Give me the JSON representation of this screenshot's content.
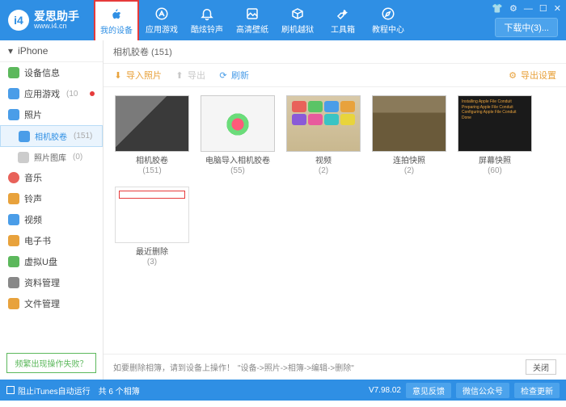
{
  "brand": {
    "name": "爱思助手",
    "url": "www.i4.cn"
  },
  "nav": [
    {
      "label": "我的设备"
    },
    {
      "label": "应用游戏"
    },
    {
      "label": "酷炫铃声"
    },
    {
      "label": "高清壁纸"
    },
    {
      "label": "刷机越狱"
    },
    {
      "label": "工具箱"
    },
    {
      "label": "教程中心"
    }
  ],
  "download_btn": "下载中(3)...",
  "sidebar": {
    "device": "iPhone",
    "items": [
      {
        "label": "设备信息"
      },
      {
        "label": "应用游戏",
        "count": "(10",
        "dot": true
      },
      {
        "label": "照片"
      },
      {
        "label": "相机胶卷",
        "count": "(151)",
        "sub": true,
        "selected": true
      },
      {
        "label": "照片图库",
        "count": "(0)",
        "sub": true
      },
      {
        "label": "音乐"
      },
      {
        "label": "铃声"
      },
      {
        "label": "视频"
      },
      {
        "label": "电子书"
      },
      {
        "label": "虚拟U盘"
      },
      {
        "label": "资料管理"
      },
      {
        "label": "文件管理"
      }
    ],
    "help": "频繁出现操作失败？"
  },
  "crumb": "相机胶卷 (151)",
  "toolbar": {
    "import": "导入照片",
    "export": "导出",
    "refresh": "刷新",
    "settings": "导出设置"
  },
  "albums": [
    {
      "name": "相机胶卷",
      "count": "(151)",
      "t": "t1"
    },
    {
      "name": "电脑导入相机胶卷",
      "count": "(55)",
      "t": "t2"
    },
    {
      "name": "视频",
      "count": "(2)",
      "t": "t3"
    },
    {
      "name": "连拍快照",
      "count": "(2)",
      "t": "t4"
    },
    {
      "name": "屏幕快照",
      "count": "(60)",
      "t": "t5"
    },
    {
      "name": "最近删除",
      "count": "(3)",
      "t": "t6"
    }
  ],
  "hint": {
    "text": "如要删除相簿，请到设备上操作！",
    "path": "\"设备->照片->相簿->编辑->删除\"",
    "close": "关闭"
  },
  "status": {
    "itunes": "阻止iTunes自动运行",
    "count": "共 6 个相簿",
    "version": "V7.98.02",
    "feedback": "意见反馈",
    "wechat": "微信公众号",
    "update": "检查更新"
  }
}
